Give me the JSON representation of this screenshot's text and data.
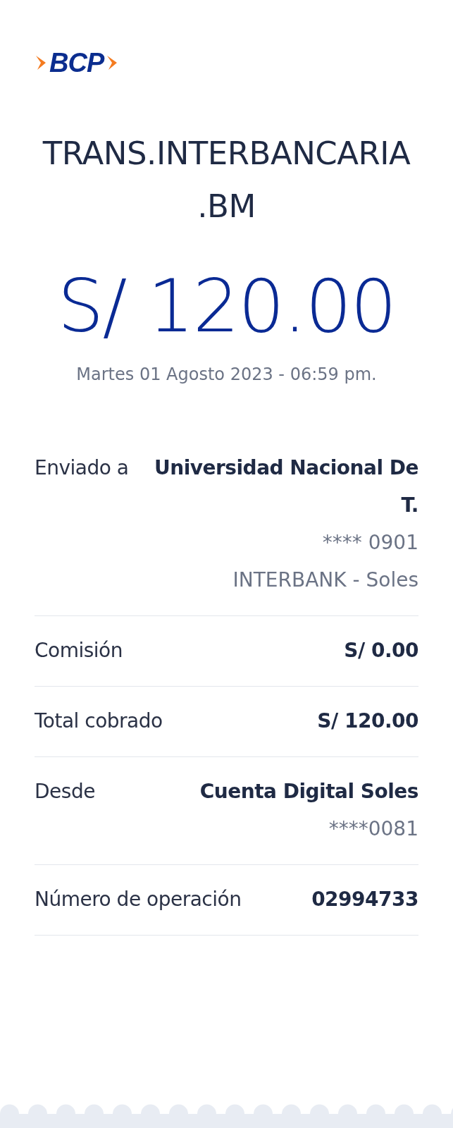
{
  "logo": {
    "text": "BCP"
  },
  "title": "TRANS.INTERBANCARIA .BM",
  "amount": "S/ 120.00",
  "datetime": "Martes 01 Agosto 2023 - 06:59 pm.",
  "details": [
    {
      "label": "Enviado a",
      "value": "Universidad Nacional De T.",
      "lines": [
        "**** 0901",
        "INTERBANK - Soles"
      ]
    },
    {
      "label": "Comisión",
      "value": "S/ 0.00"
    },
    {
      "label": "Total cobrado",
      "value": "S/ 120.00"
    },
    {
      "label": "Desde",
      "value": "Cuenta Digital Soles",
      "lines": [
        "****0081"
      ]
    },
    {
      "label": "Número de operación",
      "value": "02994733"
    }
  ]
}
